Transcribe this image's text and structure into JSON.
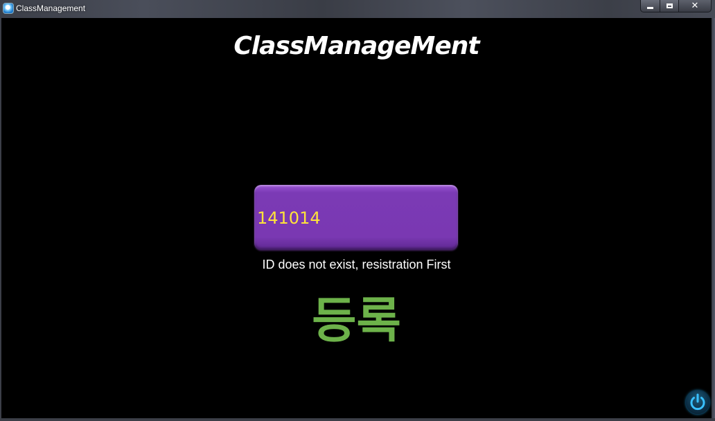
{
  "window": {
    "title": "ClassManagement",
    "controls": {
      "minimize": "minimize",
      "maximize": "maximize",
      "close": "close"
    }
  },
  "app": {
    "title": "ClassManageMent",
    "id_input": {
      "value": "141014"
    },
    "status_message": "ID does not exist, resistration First",
    "register_button_label": "등록",
    "power_icon": "power-icon"
  },
  "colors": {
    "background": "#000000",
    "input_fill": "#7b3ab5",
    "input_text": "#ffe43a",
    "register_text": "#6db24a",
    "power_glow": "#1b8fc4"
  }
}
